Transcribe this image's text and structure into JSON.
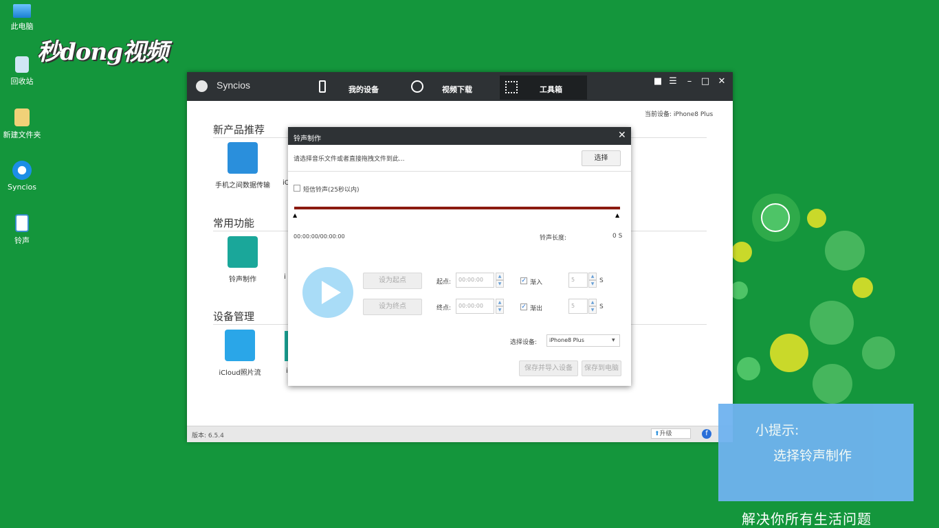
{
  "desktop": {
    "icons": [
      {
        "label": "此电脑",
        "icon": "computer-icon"
      },
      {
        "label": "回收站",
        "icon": "recycle-bin-icon"
      },
      {
        "label": "新建文件夹",
        "icon": "folder-icon"
      },
      {
        "label": "Syncios",
        "icon": "syncios-icon"
      },
      {
        "label": "铃声",
        "icon": "ringtone-file-icon"
      }
    ],
    "watermark": "秒dong视频"
  },
  "app": {
    "title": "Syncios",
    "tabs": [
      {
        "label": "我的设备",
        "icon": "phone-icon"
      },
      {
        "label": "视频下载",
        "icon": "play-circle-icon"
      },
      {
        "label": "工具箱",
        "icon": "grid-icon",
        "active": true
      }
    ],
    "current_device": "当前设备: iPhone8 Plus",
    "sections": [
      {
        "title": "新产品推荐",
        "items": [
          {
            "label": "手机之间数据传输",
            "icon": "transfer-icon",
            "color": "#2a8fdc"
          },
          {
            "label": "iO",
            "icon": "partial-icon"
          }
        ]
      },
      {
        "title": "常用功能",
        "items": [
          {
            "label": "铃声制作",
            "icon": "bell-icon",
            "color": "#1aa79a"
          },
          {
            "label": "i",
            "icon": "partial-icon"
          }
        ]
      },
      {
        "title": "设备管理",
        "items": [
          {
            "label": "iCloud照片流",
            "icon": "cloud-icon",
            "color": "#2aa6e8"
          },
          {
            "label": "i",
            "icon": "partial-icon"
          }
        ]
      }
    ],
    "version": "版本: 6.5.4",
    "upgrade": "升级"
  },
  "dialog": {
    "title": "铃声制作",
    "file_prompt": "请选择音乐文件或者直接拖拽文件到此...",
    "choose_button": "选择",
    "sms_ringtone": "短信铃声(25秒以内)",
    "time_display": "00:00:00/00:00:00",
    "length_label": "铃声长度:",
    "length_value": "0 S",
    "set_start": "设为起点",
    "set_end": "设为终点",
    "start_label": "起点:",
    "end_label": "终点:",
    "start_value": "00:00:00",
    "end_value": "00:00:00",
    "fade_in": "渐入",
    "fade_out": "渐出",
    "fade_in_value": "5",
    "fade_out_value": "5",
    "unit": "S",
    "device_label": "选择设备:",
    "device_value": "iPhone8 Plus",
    "save_device": "保存并导入设备",
    "save_pc": "保存到电脑"
  },
  "tip": {
    "heading": "小提示:",
    "body": "选择铃声制作",
    "footer": "解决你所有生活问题"
  },
  "colors": {
    "desktop": "#14963c",
    "titlebar": "#2e3235",
    "progress": "#8b1a10",
    "tip": "#6fb3f0"
  }
}
